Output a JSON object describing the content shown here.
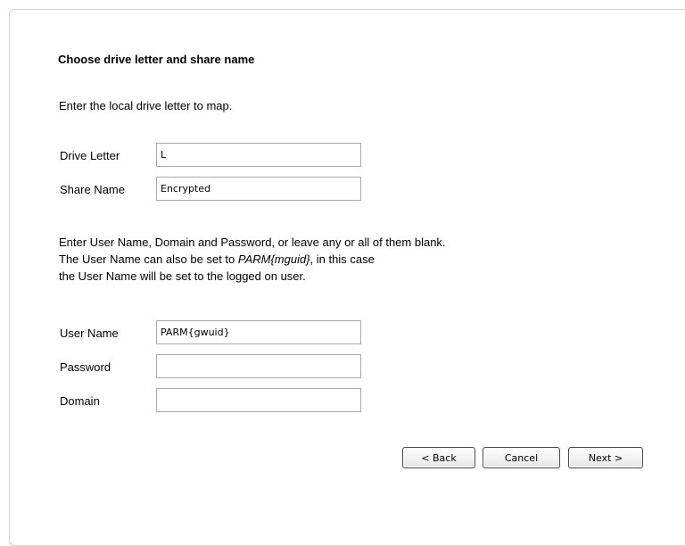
{
  "heading": "Choose drive letter and share name",
  "drive_intro": "Enter the local drive letter to map.",
  "drive_letter": {
    "label": "Drive Letter",
    "value": "L"
  },
  "share_name": {
    "label": "Share Name",
    "value": "Encrypted"
  },
  "credentials_intro": {
    "line1": "Enter User Name, Domain and Password, or leave any or all of them blank.",
    "line2_prefix": "The User Name can also be set to ",
    "line2_italic": "PARM{mguid}",
    "line2_suffix": ", in this case",
    "line3": "the User Name will be set to the logged on user."
  },
  "user_name": {
    "label": "User Name",
    "value": "PARM{gwuid}"
  },
  "password": {
    "label": "Password",
    "value": ""
  },
  "domain": {
    "label": "Domain",
    "value": ""
  },
  "buttons": {
    "back": "< Back",
    "cancel": "Cancel",
    "next": "Next >"
  }
}
